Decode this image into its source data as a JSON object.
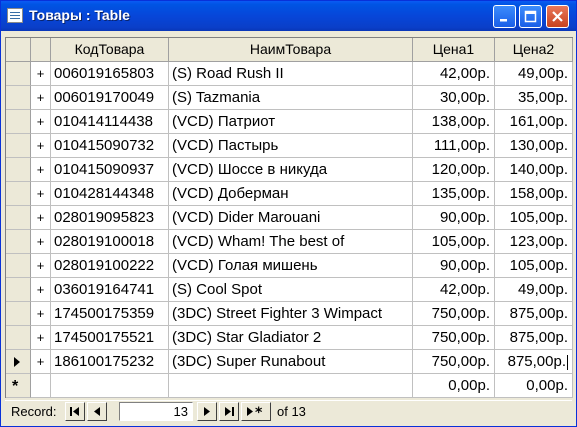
{
  "window": {
    "title": "Товары : Table"
  },
  "columns": [
    "КодТовара",
    "НаимТовара",
    "Цена1",
    "Цена2"
  ],
  "rows": [
    {
      "code": "006019165803",
      "name": "(S) Road Rush II",
      "price1": "42,00р.",
      "price2": "49,00р."
    },
    {
      "code": "006019170049",
      "name": "(S) Tazmania",
      "price1": "30,00р.",
      "price2": "35,00р."
    },
    {
      "code": "010414114438",
      "name": "(VCD) Патриот",
      "price1": "138,00р.",
      "price2": "161,00р."
    },
    {
      "code": "010415090732",
      "name": "(VCD) Пастырь",
      "price1": "111,00р.",
      "price2": "130,00р."
    },
    {
      "code": "010415090937",
      "name": "(VCD) Шоссе в никуда",
      "price1": "120,00р.",
      "price2": "140,00р."
    },
    {
      "code": "010428144348",
      "name": "(VCD) Доберман",
      "price1": "135,00р.",
      "price2": "158,00р."
    },
    {
      "code": "028019095823",
      "name": "(VCD) Dider Marouani",
      "price1": "90,00р.",
      "price2": "105,00р."
    },
    {
      "code": "028019100018",
      "name": "(VCD) Wham! The best of",
      "price1": "105,00р.",
      "price2": "123,00р."
    },
    {
      "code": "028019100222",
      "name": "(VCD) Голая мишень",
      "price1": "90,00р.",
      "price2": "105,00р."
    },
    {
      "code": "036019164741",
      "name": "(S) Cool Spot",
      "price1": "42,00р.",
      "price2": "49,00р."
    },
    {
      "code": "174500175359",
      "name": "(3DC) Street Fighter 3 Wimpact",
      "price1": "750,00р.",
      "price2": "875,00р."
    },
    {
      "code": "174500175521",
      "name": "(3DC) Star Gladiator 2",
      "price1": "750,00р.",
      "price2": "875,00р."
    },
    {
      "code": "186100175232",
      "name": "(3DC) Super Runabout",
      "price1": "750,00р.",
      "price2": "875,00р."
    }
  ],
  "new_row": {
    "price1": "0,00р.",
    "price2": "0,00р."
  },
  "expand_symbol": "+",
  "new_row_symbol": "*",
  "current_row_index": 12,
  "navigation": {
    "label": "Record:",
    "current": "13",
    "total_text": "of 13"
  }
}
